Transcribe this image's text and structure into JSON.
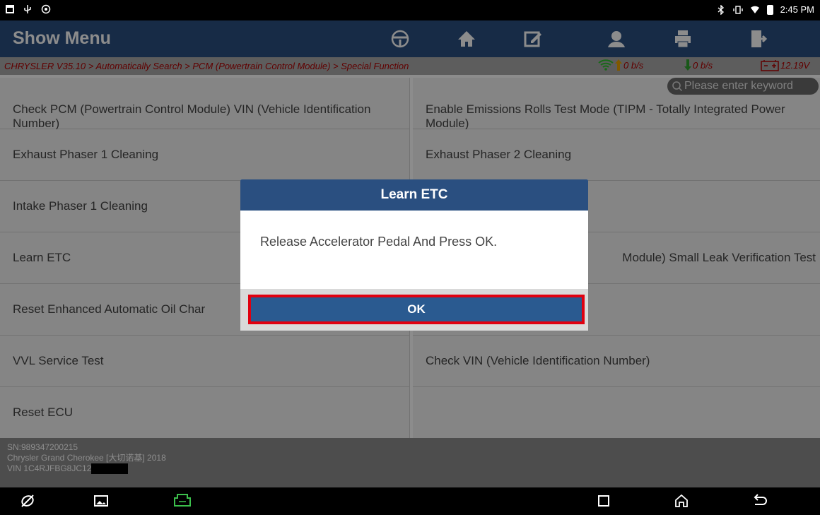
{
  "statusbar": {
    "time": "2:45 PM"
  },
  "header": {
    "title": "Show Menu",
    "buttons": [
      "steering-wheel-icon",
      "home-icon",
      "edit-report-icon",
      "user-icon",
      "print-icon",
      "exit-icon"
    ]
  },
  "breadcrumb": {
    "path": "CHRYSLER V35.10 > Automatically Search > PCM (Powertrain Control Module) > Special Function",
    "upload": "0 b/s",
    "download": "0 b/s",
    "voltage": "12.19V"
  },
  "search": {
    "placeholder": "Please enter keyword"
  },
  "menu": {
    "rows": [
      {
        "left": "Check PCM (Powertrain Control Module) VIN (Vehicle Identification Number)",
        "right": "Enable Emissions Rolls Test Mode (TIPM - Totally Integrated Power Module)"
      },
      {
        "left": "Exhaust Phaser 1 Cleaning",
        "right": "Exhaust Phaser 2 Cleaning"
      },
      {
        "left": "Intake Phaser 1 Cleaning",
        "right": ""
      },
      {
        "left": "Learn ETC",
        "right": "Module) Small Leak Verification Test"
      },
      {
        "left": "Reset Enhanced Automatic Oil Char",
        "right": ""
      },
      {
        "left": "VVL Service Test",
        "right": "Check VIN (Vehicle Identification Number)"
      },
      {
        "left": "Reset ECU",
        "right": ""
      }
    ]
  },
  "footer": {
    "sn": "SN:989347200215",
    "vehicle": "Chrysler Grand Cherokee [大切诺基] 2018",
    "vin": "VIN 1C4RJFBG8JC12"
  },
  "dialog": {
    "title": "Learn ETC",
    "message": "Release Accelerator Pedal And Press OK.",
    "ok_label": "OK"
  },
  "colors": {
    "header_bg": "#2a4f80",
    "ok_highlight": "#e00010",
    "crumb_text": "#b00000"
  }
}
